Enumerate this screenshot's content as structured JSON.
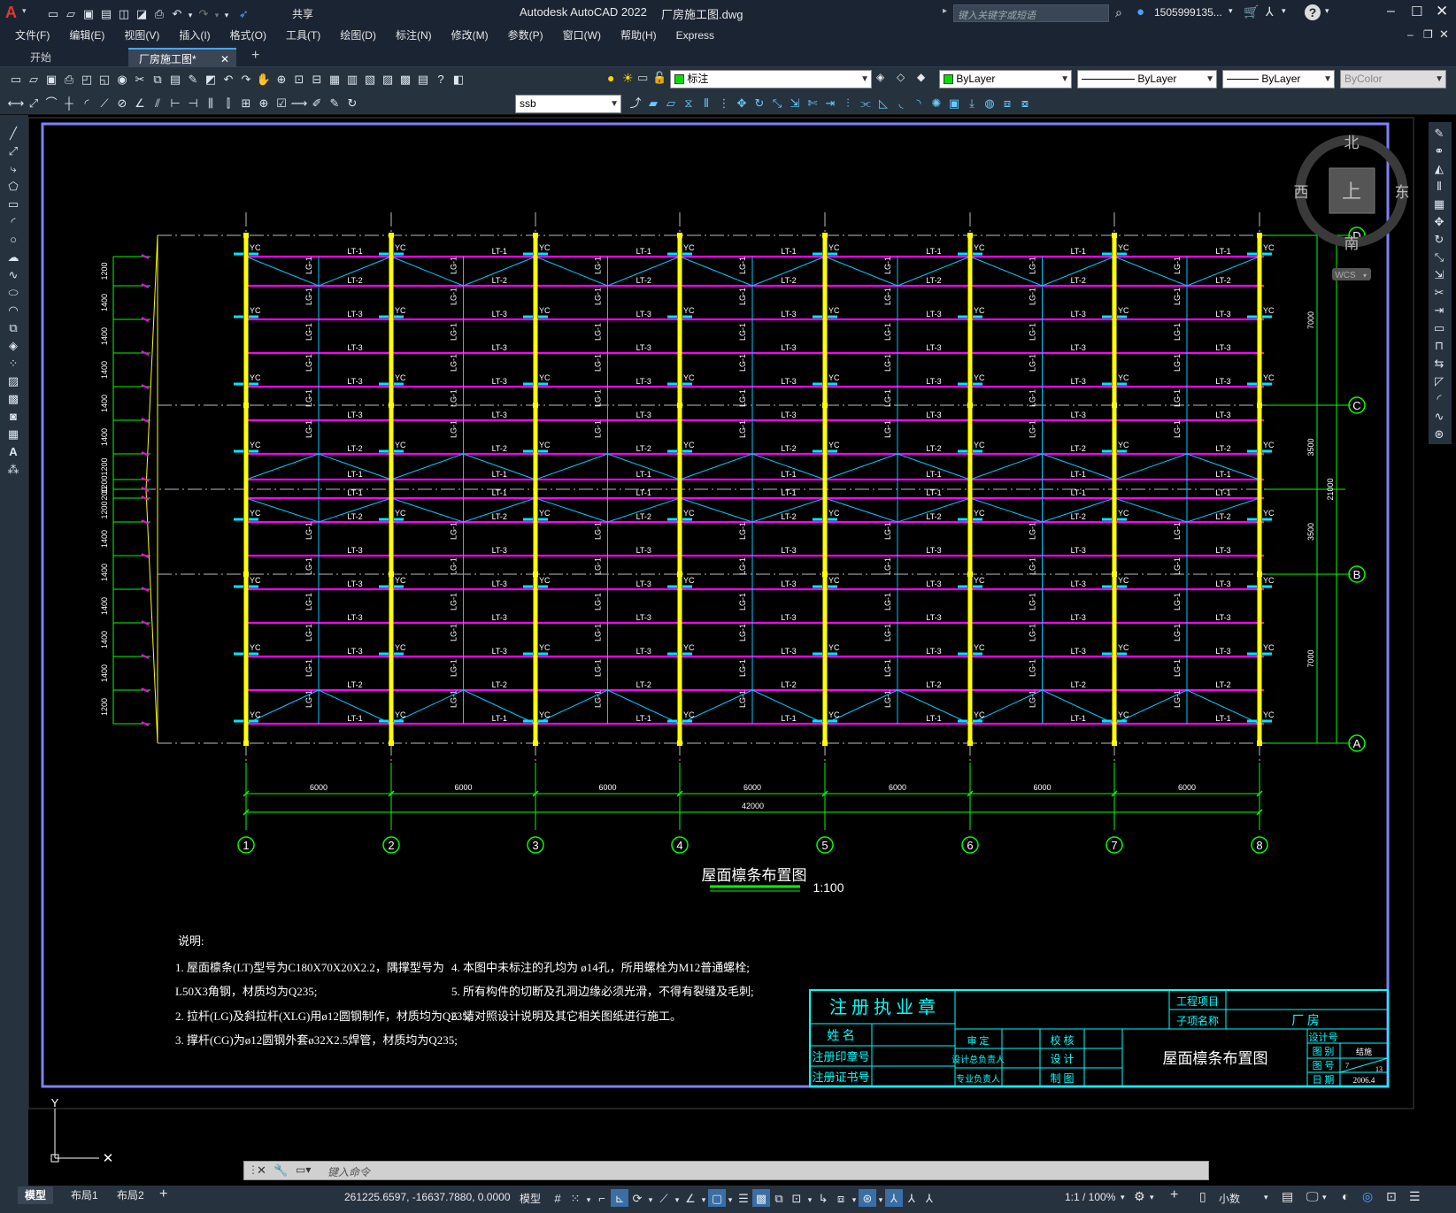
{
  "app": {
    "title": "Autodesk AutoCAD 2022",
    "filename": "厂房施工图.dwg",
    "logo": "A",
    "share": "共享",
    "search_placeholder": "键入关键字或短语",
    "user": "1505999135...",
    "brand_red": "#e03a2f"
  },
  "menu": [
    "文件(F)",
    "编辑(E)",
    "视图(V)",
    "插入(I)",
    "格式(O)",
    "工具(T)",
    "绘图(D)",
    "标注(N)",
    "修改(M)",
    "参数(P)",
    "窗口(W)",
    "帮助(H)",
    "Express"
  ],
  "tabs": {
    "start": "开始",
    "active": "厂房施工图*"
  },
  "toolbar": {
    "layer": "标注",
    "color": "ByLayer",
    "linetype": "ByLayer",
    "lineweight": "ByLayer",
    "plotstyle": "ByColor",
    "dimstyle": "ssb"
  },
  "viewcube": {
    "north": "北",
    "south": "南",
    "east": "东",
    "west": "西",
    "top": "上",
    "wcs": "WCS"
  },
  "drawing": {
    "grid_numbers": [
      "1",
      "2",
      "3",
      "4",
      "5",
      "6",
      "7",
      "8"
    ],
    "grid_letters": [
      "D",
      "C",
      "B",
      "A"
    ],
    "bay_dims": [
      "6000",
      "6000",
      "6000",
      "6000",
      "6000",
      "6000",
      "6000"
    ],
    "total_dim": "42000",
    "right_dims": [
      "7000",
      "3500",
      "3500",
      "7000"
    ],
    "right_total": "21000",
    "left_dims": [
      "1200",
      "1400",
      "1400",
      "1400",
      "1400",
      "1400",
      "1200",
      "1200",
      "200",
      "1200",
      "1400",
      "1400",
      "1400",
      "1400",
      "1400",
      "1200"
    ],
    "plan_title": "屋面檩条布置图",
    "plan_scale": "1:100"
  },
  "notes": {
    "heading": "说明:",
    "left": [
      "1. 屋面檩条(LT)型号为C180X70X20X2.2，隅撑型号为",
      "   L50X3角钢，材质均为Q235;",
      "2. 拉杆(LG)及斜拉杆(XLG)用ø12圆钢制作，材质均为Q235;",
      "3. 撑杆(CG)为ø12圆钢外套ø32X2.5焊管，材质均为Q235;"
    ],
    "right": [
      "4. 本图中未标注的孔均为 ø14孔，所用螺栓为M12普通螺栓;",
      "5. 所有构件的切断及孔洞边缘必须光滑，不得有裂缝及毛刺;",
      "6. 请对照设计说明及其它相关图纸进行施工。"
    ]
  },
  "titleblock": {
    "stamp": "注 册 执 业 章",
    "name": "姓  名",
    "seal": "注册印章号",
    "cert": "注册证书号",
    "project_label": "工程项目",
    "sub_label": "子项名称",
    "sub_value": "厂    房",
    "roles_left": [
      "审  定",
      "设计总负责人",
      "专业负责人"
    ],
    "roles_right": [
      "校  核",
      "设  计",
      "制  图"
    ],
    "drawing_name": "屋面檩条布置图",
    "design_no": "设计号",
    "dwg_type": "图  别",
    "dwg_no": "图  号",
    "date": "日  期",
    "type_val": "结施",
    "no_val": "7",
    "no_total": "13",
    "date_val": "2006.4"
  },
  "command": {
    "placeholder": "键入命令"
  },
  "layout_tabs": [
    "模型",
    "布局1",
    "布局2"
  ],
  "status": {
    "coords": "261225.6597, -16637.7880, 0.0000",
    "mode": "模型",
    "scale": "1:1 / 100%",
    "units": "小数"
  },
  "colors": {
    "grid": "#00ff00",
    "purlin": "#ff00ff",
    "column": "#ffff00",
    "brace": "#00c8ff",
    "border": "#8080ff",
    "titleblock": "#00ffff"
  }
}
